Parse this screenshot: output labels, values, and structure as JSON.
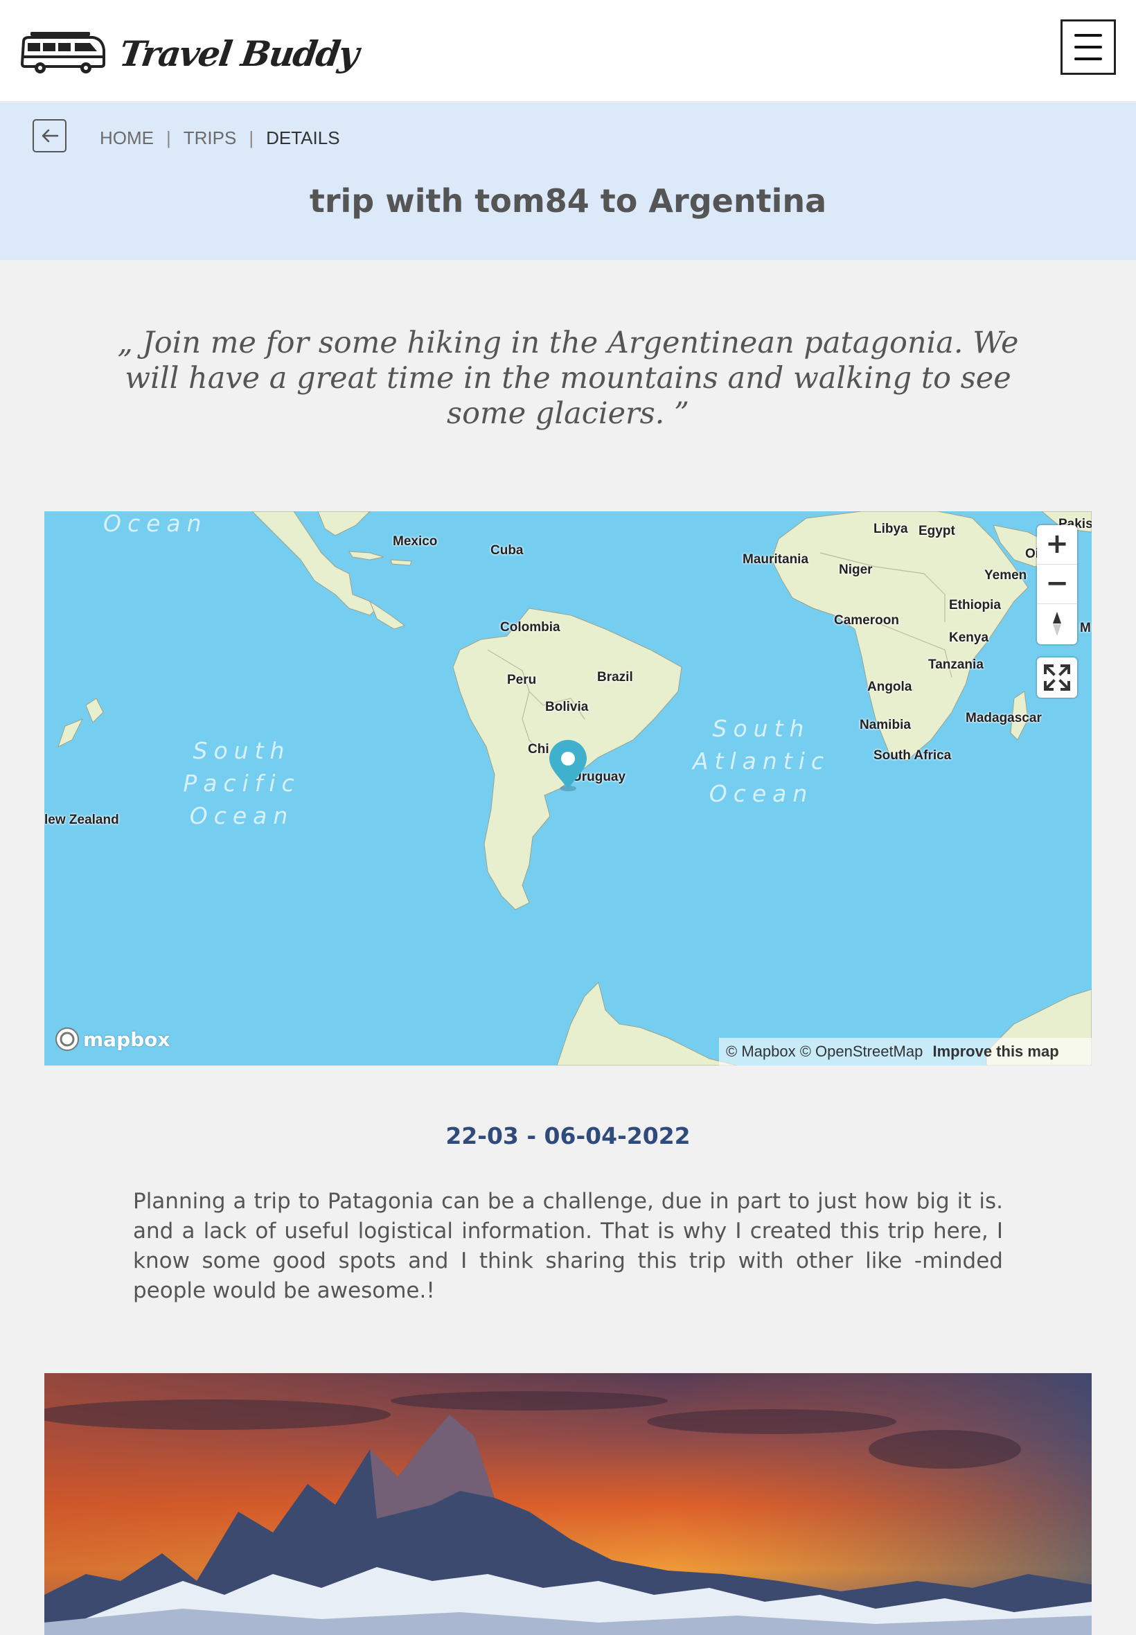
{
  "header": {
    "brand_name": "Travel Buddy",
    "logo_icon": "camper-van-icon",
    "menu_icon": "hamburger-menu-icon"
  },
  "breadcrumb": {
    "back_icon": "arrow-left-icon",
    "items": [
      "HOME",
      "TRIPS",
      "DETAILS"
    ],
    "separator": "|"
  },
  "page_title": "trip with tom84 to Argentina",
  "quote": "„ Join me for some hiking in the Argentinean patagonia. We will have a great time in the mountains and walking to see some glaciers. ”",
  "map": {
    "labels": {
      "mexico": "Mexico",
      "cuba": "Cuba",
      "colombia": "Colombia",
      "peru": "Peru",
      "brazil": "Brazil",
      "bolivia": "Bolivia",
      "chile": "Chi",
      "uruguay": "Uruguay",
      "new_zealand": "lew Zealand",
      "libya": "Libya",
      "egypt": "Egypt",
      "mauritania": "Mauritania",
      "niger": "Niger",
      "yemen": "Yemen",
      "ethiopia": "Ethiopia",
      "cameroon": "Cameroon",
      "kenya": "Kenya",
      "tanzania": "Tanzania",
      "angola": "Angola",
      "namibia": "Namibia",
      "madagascar": "Madagascar",
      "south_africa": "South Africa",
      "pakistan": "Pakis",
      "oman": "Oi",
      "somalia": "M"
    },
    "oceans": {
      "top": "Ocean",
      "south_pacific": "South Pacific Ocean",
      "south_atlantic": "South Atlantic Ocean"
    },
    "controls": {
      "zoom_in": "+",
      "zoom_out": "−",
      "compass_icon": "compass-icon",
      "fullscreen_icon": "fullscreen-icon"
    },
    "provider_logo": "mapbox",
    "attribution": {
      "mapbox": "© Mapbox",
      "osm": "© OpenStreetMap",
      "improve": "Improve this map"
    },
    "marker_icon": "map-pin-icon"
  },
  "trip": {
    "dates": "22-03 - 06-04-2022",
    "description": "Planning a trip to Patagonia can be a challenge, due in part to just how big it is. and a lack of useful logistical information. That is why I created this trip here, I know some good spots and I think sharing this trip with other like -minded people would be awesome.!"
  },
  "photo": {
    "subject": "mountain-sunset-photo"
  },
  "colors": {
    "header_bg": "#ffffff",
    "band_bg": "#dce9f9",
    "page_bg": "#f1f1f1",
    "ocean": "#75cdf0",
    "land": "#e8efcf",
    "accent_dates": "#2f4b7c",
    "marker": "#3fb1ce"
  }
}
